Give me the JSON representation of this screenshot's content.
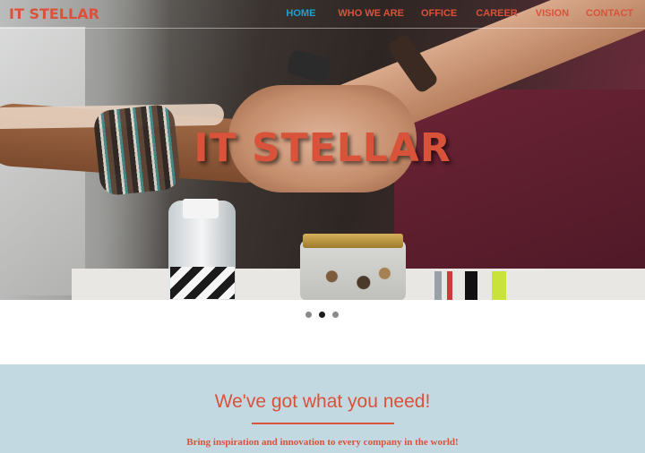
{
  "nav": {
    "brand": "IT STELLAR",
    "items": [
      {
        "label": "HOME",
        "active": true
      },
      {
        "label": "WHO WE ARE",
        "active": false
      },
      {
        "label": "OFFICE",
        "active": false
      },
      {
        "label": "CAREER",
        "active": false
      },
      {
        "label": "VISION",
        "active": false
      },
      {
        "label": "CONTACT",
        "active": false
      }
    ]
  },
  "hero": {
    "title": "IT STELLAR",
    "image_description_icon": "team-hands-photo"
  },
  "carousel": {
    "slides": 3,
    "active_index": 1
  },
  "section": {
    "title": "We've got what you need!",
    "tagline": "Bring inspiration and innovation to every company in the world!"
  },
  "colors": {
    "accent": "#d9523a",
    "active_link": "#1fa0d2",
    "section_bg": "#c3d9e2"
  }
}
